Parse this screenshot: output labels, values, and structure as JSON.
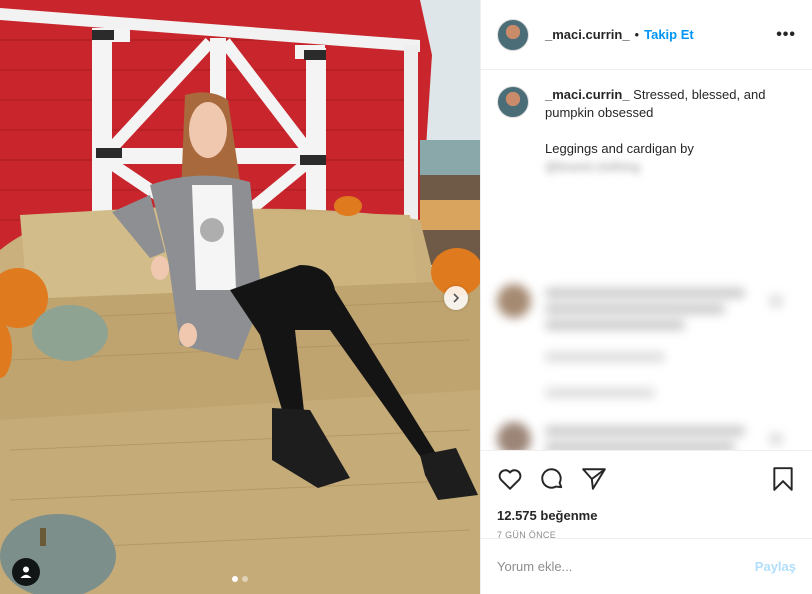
{
  "post": {
    "username": "_maci.currin_",
    "follow_label": "Takip Et",
    "separator": "•",
    "more_label": "•••",
    "caption": {
      "author": "_maci.currin_",
      "line1": "Stressed, blessed, and pumpkin obsessed",
      "line2": "Leggings and cardigan by",
      "mention_blurred": "@brand.clothing"
    },
    "likes_text": "12.575 beğenme",
    "time_text": "7 GÜN ÖNCE",
    "comment_placeholder": "Yorum ekle...",
    "post_label": "Paylaş",
    "carousel": {
      "slide_count": 2,
      "active_index": 0
    },
    "colors": {
      "accent": "#0095f6",
      "post_disabled": "#b2dffc",
      "text": "#262626",
      "muted": "#8e8e8e"
    }
  }
}
